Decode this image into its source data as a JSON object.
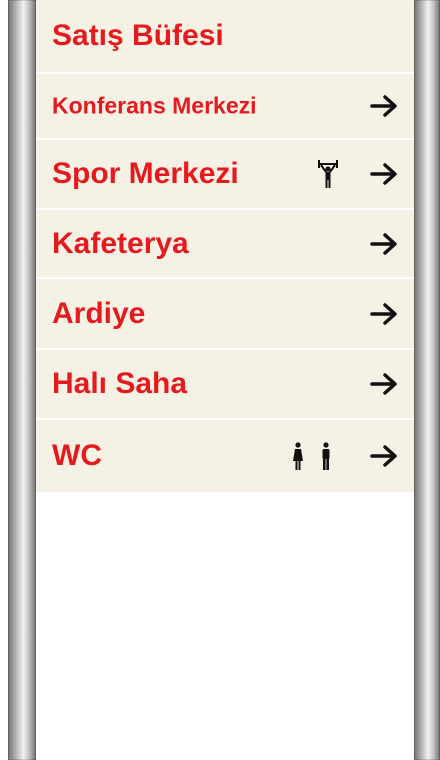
{
  "signs": [
    {
      "label": "Satış Büfesi"
    },
    {
      "label": "Konferans Merkezi",
      "direction": "right"
    },
    {
      "label": "Spor Merkezi",
      "icon": "weightlifter-icon",
      "direction": "right"
    },
    {
      "label": "Kafeterya",
      "direction": "right"
    },
    {
      "label": "Ardiye",
      "direction": "right"
    },
    {
      "label": "Halı Saha",
      "direction": "right"
    },
    {
      "label": "WC",
      "icons": [
        "woman-icon",
        "man-icon"
      ],
      "direction": "right"
    }
  ],
  "colors": {
    "text": "#e5191e",
    "panel": "#f5f1e4",
    "icon": "#111111"
  }
}
